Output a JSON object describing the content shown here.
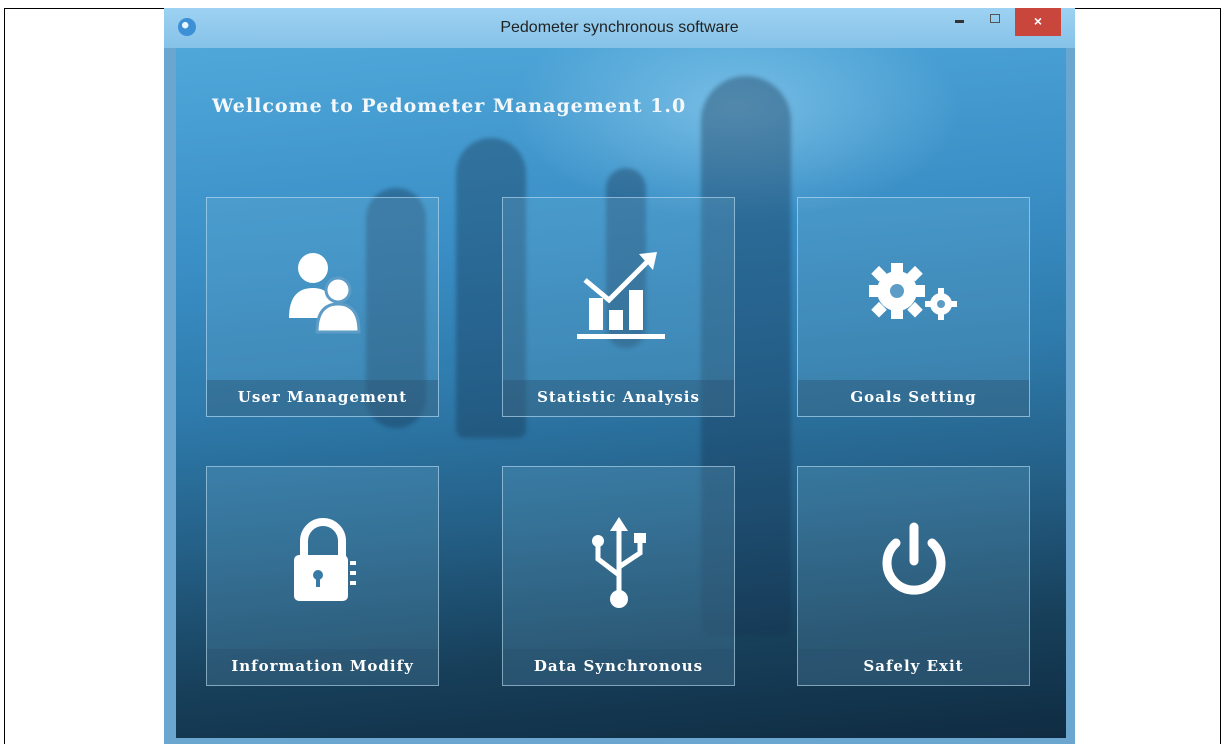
{
  "window": {
    "title": "Pedometer synchronous software",
    "close_label": "×"
  },
  "welcome": "Wellcome to Pedometer Management 1.0",
  "tiles": [
    {
      "label": "User Management",
      "icon": "users-icon"
    },
    {
      "label": "Statistic Analysis",
      "icon": "chart-icon"
    },
    {
      "label": "Goals Setting",
      "icon": "gears-icon"
    },
    {
      "label": "Information Modify",
      "icon": "lock-icon"
    },
    {
      "label": "Data Synchronous",
      "icon": "usb-icon"
    },
    {
      "label": "Safely Exit",
      "icon": "power-icon"
    }
  ],
  "colors": {
    "title_bar": "#9dd2f2",
    "close_button": "#c9463d",
    "tile_border": "#c8e6fa"
  }
}
